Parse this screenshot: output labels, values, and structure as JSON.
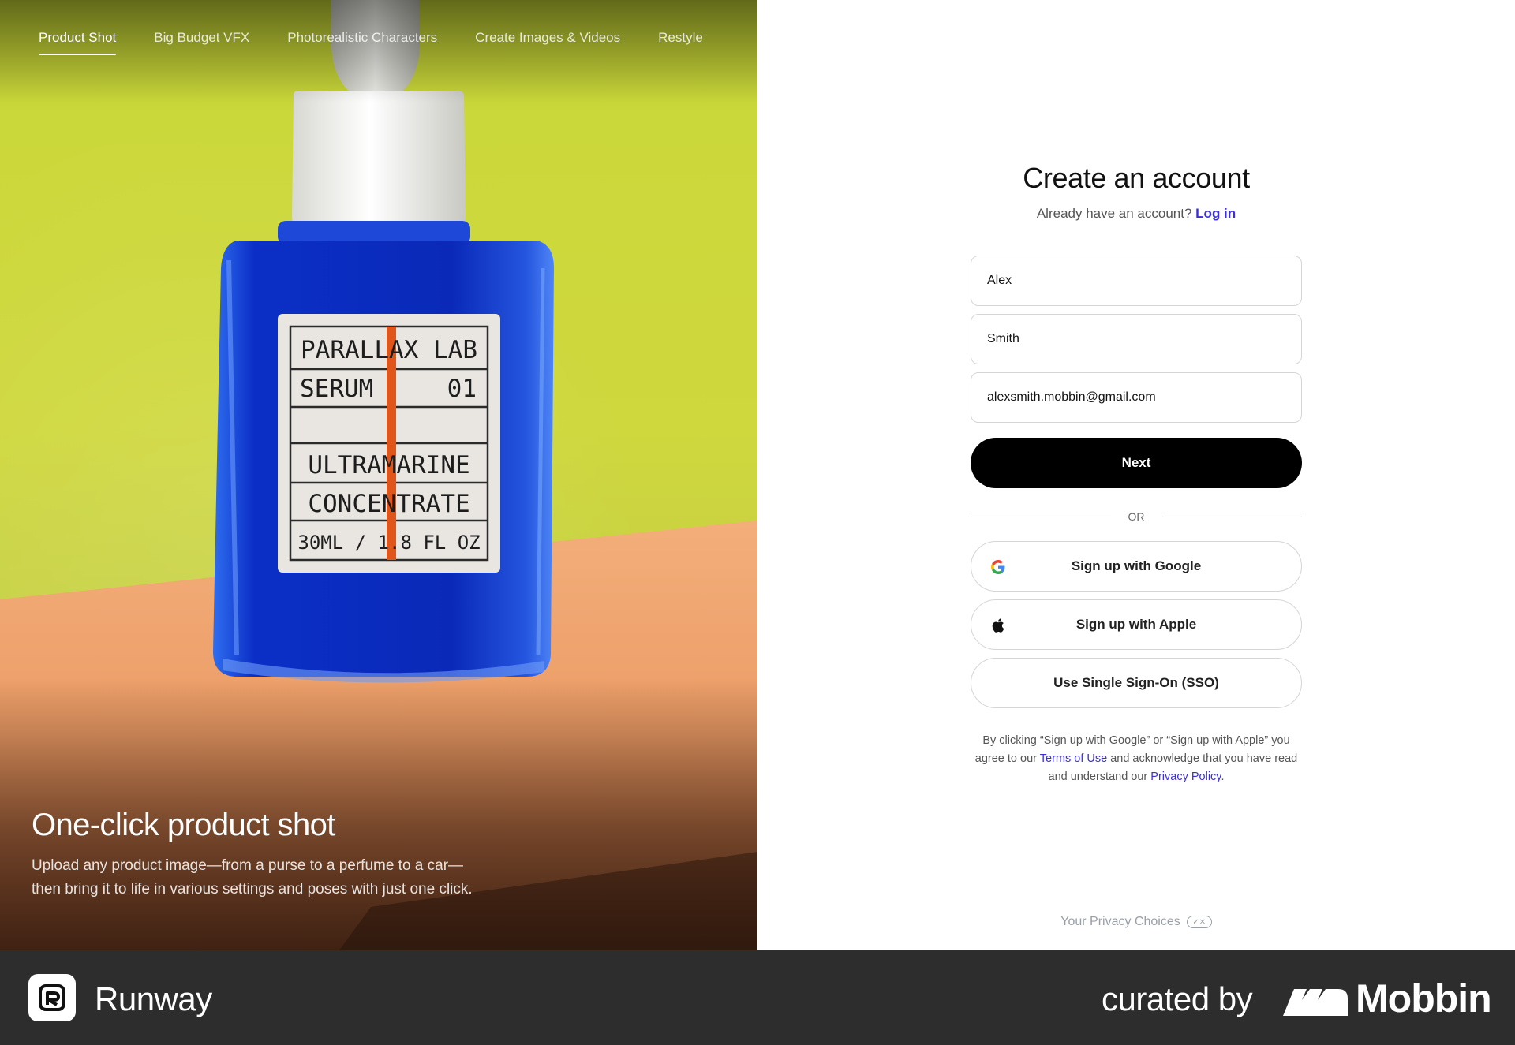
{
  "hero": {
    "tabs": [
      {
        "label": "Product Shot",
        "active": true
      },
      {
        "label": "Big Budget VFX",
        "active": false
      },
      {
        "label": "Photorealistic Characters",
        "active": false
      },
      {
        "label": "Create Images & Videos",
        "active": false
      },
      {
        "label": "Restyle",
        "active": false
      }
    ],
    "title": "One-click product shot",
    "description_line1": "Upload any product image—from a purse to a perfume to a car—",
    "description_line2": "then bring it to life in various settings and poses with just one click.",
    "label": {
      "line1": "PARALLAX LAB",
      "line2_left": "SERUM",
      "line2_right": "01",
      "line4": "ULTRAMARINE",
      "line5": "CONCENTRATE",
      "line6": "30ML / 1.8 FL OZ"
    },
    "colors": {
      "wall": "#cfd83d",
      "table": "#f0a56e",
      "liquid": "#0a2fc0",
      "stripe": "#e0561a"
    }
  },
  "form": {
    "title": "Create an account",
    "login_prompt": "Already have an account?",
    "login_link": "Log in",
    "first_name": "Alex",
    "last_name": "Smith",
    "email": "alexsmith.mobbin@gmail.com",
    "next_button": "Next",
    "or_text": "OR",
    "google_button": "Sign up with Google",
    "apple_button": "Sign up with Apple",
    "sso_button": "Use Single Sign-On (SSO)",
    "legal_part1": "By clicking “Sign up with Google” or “Sign up with Apple” you agree to our",
    "terms_link": "Terms of Use",
    "legal_part2": "and acknowledge that you have read and understand our",
    "privacy_link": "Privacy Policy",
    "legal_end": ".",
    "privacy_choices": "Your Privacy Choices",
    "accent_color": "#3b2fd6"
  },
  "footer": {
    "brand": "Runway",
    "curated_by": "curated by",
    "mobbin": "Mobbin"
  }
}
